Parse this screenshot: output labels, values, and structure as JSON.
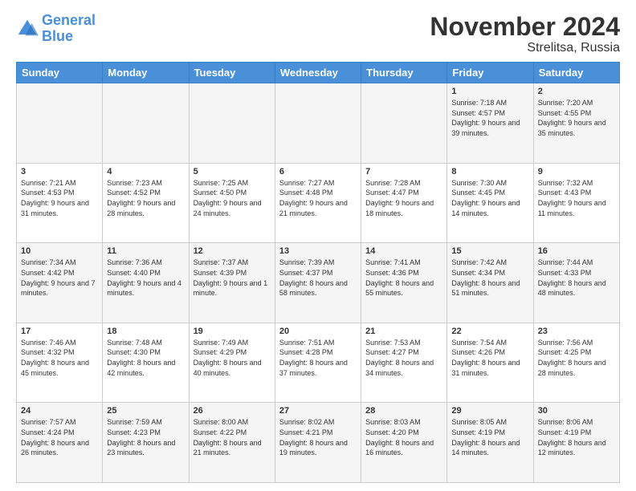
{
  "header": {
    "logo_line1": "General",
    "logo_line2": "Blue",
    "title": "November 2024",
    "subtitle": "Strelitsa, Russia"
  },
  "columns": [
    "Sunday",
    "Monday",
    "Tuesday",
    "Wednesday",
    "Thursday",
    "Friday",
    "Saturday"
  ],
  "weeks": [
    [
      {
        "day": "",
        "sunrise": "",
        "sunset": "",
        "daylight": ""
      },
      {
        "day": "",
        "sunrise": "",
        "sunset": "",
        "daylight": ""
      },
      {
        "day": "",
        "sunrise": "",
        "sunset": "",
        "daylight": ""
      },
      {
        "day": "",
        "sunrise": "",
        "sunset": "",
        "daylight": ""
      },
      {
        "day": "",
        "sunrise": "",
        "sunset": "",
        "daylight": ""
      },
      {
        "day": "1",
        "sunrise": "Sunrise: 7:18 AM",
        "sunset": "Sunset: 4:57 PM",
        "daylight": "Daylight: 9 hours and 39 minutes."
      },
      {
        "day": "2",
        "sunrise": "Sunrise: 7:20 AM",
        "sunset": "Sunset: 4:55 PM",
        "daylight": "Daylight: 9 hours and 35 minutes."
      }
    ],
    [
      {
        "day": "3",
        "sunrise": "Sunrise: 7:21 AM",
        "sunset": "Sunset: 4:53 PM",
        "daylight": "Daylight: 9 hours and 31 minutes."
      },
      {
        "day": "4",
        "sunrise": "Sunrise: 7:23 AM",
        "sunset": "Sunset: 4:52 PM",
        "daylight": "Daylight: 9 hours and 28 minutes."
      },
      {
        "day": "5",
        "sunrise": "Sunrise: 7:25 AM",
        "sunset": "Sunset: 4:50 PM",
        "daylight": "Daylight: 9 hours and 24 minutes."
      },
      {
        "day": "6",
        "sunrise": "Sunrise: 7:27 AM",
        "sunset": "Sunset: 4:48 PM",
        "daylight": "Daylight: 9 hours and 21 minutes."
      },
      {
        "day": "7",
        "sunrise": "Sunrise: 7:28 AM",
        "sunset": "Sunset: 4:47 PM",
        "daylight": "Daylight: 9 hours and 18 minutes."
      },
      {
        "day": "8",
        "sunrise": "Sunrise: 7:30 AM",
        "sunset": "Sunset: 4:45 PM",
        "daylight": "Daylight: 9 hours and 14 minutes."
      },
      {
        "day": "9",
        "sunrise": "Sunrise: 7:32 AM",
        "sunset": "Sunset: 4:43 PM",
        "daylight": "Daylight: 9 hours and 11 minutes."
      }
    ],
    [
      {
        "day": "10",
        "sunrise": "Sunrise: 7:34 AM",
        "sunset": "Sunset: 4:42 PM",
        "daylight": "Daylight: 9 hours and 7 minutes."
      },
      {
        "day": "11",
        "sunrise": "Sunrise: 7:36 AM",
        "sunset": "Sunset: 4:40 PM",
        "daylight": "Daylight: 9 hours and 4 minutes."
      },
      {
        "day": "12",
        "sunrise": "Sunrise: 7:37 AM",
        "sunset": "Sunset: 4:39 PM",
        "daylight": "Daylight: 9 hours and 1 minute."
      },
      {
        "day": "13",
        "sunrise": "Sunrise: 7:39 AM",
        "sunset": "Sunset: 4:37 PM",
        "daylight": "Daylight: 8 hours and 58 minutes."
      },
      {
        "day": "14",
        "sunrise": "Sunrise: 7:41 AM",
        "sunset": "Sunset: 4:36 PM",
        "daylight": "Daylight: 8 hours and 55 minutes."
      },
      {
        "day": "15",
        "sunrise": "Sunrise: 7:42 AM",
        "sunset": "Sunset: 4:34 PM",
        "daylight": "Daylight: 8 hours and 51 minutes."
      },
      {
        "day": "16",
        "sunrise": "Sunrise: 7:44 AM",
        "sunset": "Sunset: 4:33 PM",
        "daylight": "Daylight: 8 hours and 48 minutes."
      }
    ],
    [
      {
        "day": "17",
        "sunrise": "Sunrise: 7:46 AM",
        "sunset": "Sunset: 4:32 PM",
        "daylight": "Daylight: 8 hours and 45 minutes."
      },
      {
        "day": "18",
        "sunrise": "Sunrise: 7:48 AM",
        "sunset": "Sunset: 4:30 PM",
        "daylight": "Daylight: 8 hours and 42 minutes."
      },
      {
        "day": "19",
        "sunrise": "Sunrise: 7:49 AM",
        "sunset": "Sunset: 4:29 PM",
        "daylight": "Daylight: 8 hours and 40 minutes."
      },
      {
        "day": "20",
        "sunrise": "Sunrise: 7:51 AM",
        "sunset": "Sunset: 4:28 PM",
        "daylight": "Daylight: 8 hours and 37 minutes."
      },
      {
        "day": "21",
        "sunrise": "Sunrise: 7:53 AM",
        "sunset": "Sunset: 4:27 PM",
        "daylight": "Daylight: 8 hours and 34 minutes."
      },
      {
        "day": "22",
        "sunrise": "Sunrise: 7:54 AM",
        "sunset": "Sunset: 4:26 PM",
        "daylight": "Daylight: 8 hours and 31 minutes."
      },
      {
        "day": "23",
        "sunrise": "Sunrise: 7:56 AM",
        "sunset": "Sunset: 4:25 PM",
        "daylight": "Daylight: 8 hours and 28 minutes."
      }
    ],
    [
      {
        "day": "24",
        "sunrise": "Sunrise: 7:57 AM",
        "sunset": "Sunset: 4:24 PM",
        "daylight": "Daylight: 8 hours and 26 minutes."
      },
      {
        "day": "25",
        "sunrise": "Sunrise: 7:59 AM",
        "sunset": "Sunset: 4:23 PM",
        "daylight": "Daylight: 8 hours and 23 minutes."
      },
      {
        "day": "26",
        "sunrise": "Sunrise: 8:00 AM",
        "sunset": "Sunset: 4:22 PM",
        "daylight": "Daylight: 8 hours and 21 minutes."
      },
      {
        "day": "27",
        "sunrise": "Sunrise: 8:02 AM",
        "sunset": "Sunset: 4:21 PM",
        "daylight": "Daylight: 8 hours and 19 minutes."
      },
      {
        "day": "28",
        "sunrise": "Sunrise: 8:03 AM",
        "sunset": "Sunset: 4:20 PM",
        "daylight": "Daylight: 8 hours and 16 minutes."
      },
      {
        "day": "29",
        "sunrise": "Sunrise: 8:05 AM",
        "sunset": "Sunset: 4:19 PM",
        "daylight": "Daylight: 8 hours and 14 minutes."
      },
      {
        "day": "30",
        "sunrise": "Sunrise: 8:06 AM",
        "sunset": "Sunset: 4:19 PM",
        "daylight": "Daylight: 8 hours and 12 minutes."
      }
    ]
  ]
}
